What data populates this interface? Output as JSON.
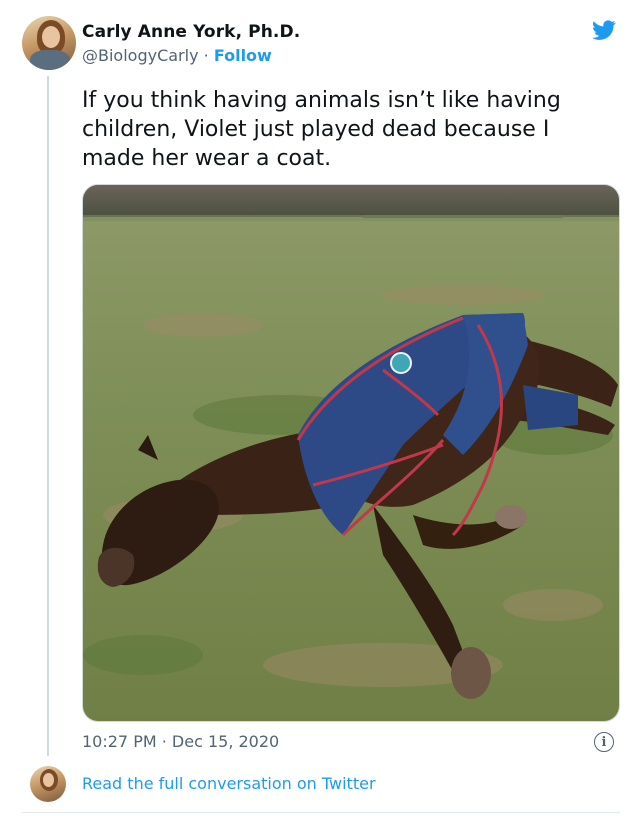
{
  "author": {
    "name": "Carly Anne York, Ph.D.",
    "handle": "@BiologyCarly",
    "separator": " · ",
    "follow_label": "Follow"
  },
  "tweet": {
    "text": "If you think having animals isn’t like having children, Violet just played dead because I made her wear a coat.",
    "time": "10:27 PM",
    "date_separator": " · ",
    "date": "Dec 15, 2020"
  },
  "footer": {
    "read_link": "Read the full conversation on Twitter"
  },
  "icons": {
    "brand": "twitter-bird-icon",
    "info": "info-icon"
  },
  "colors": {
    "accent": "#1d9bf0",
    "text": "#0f1419",
    "secondary": "#536471"
  }
}
